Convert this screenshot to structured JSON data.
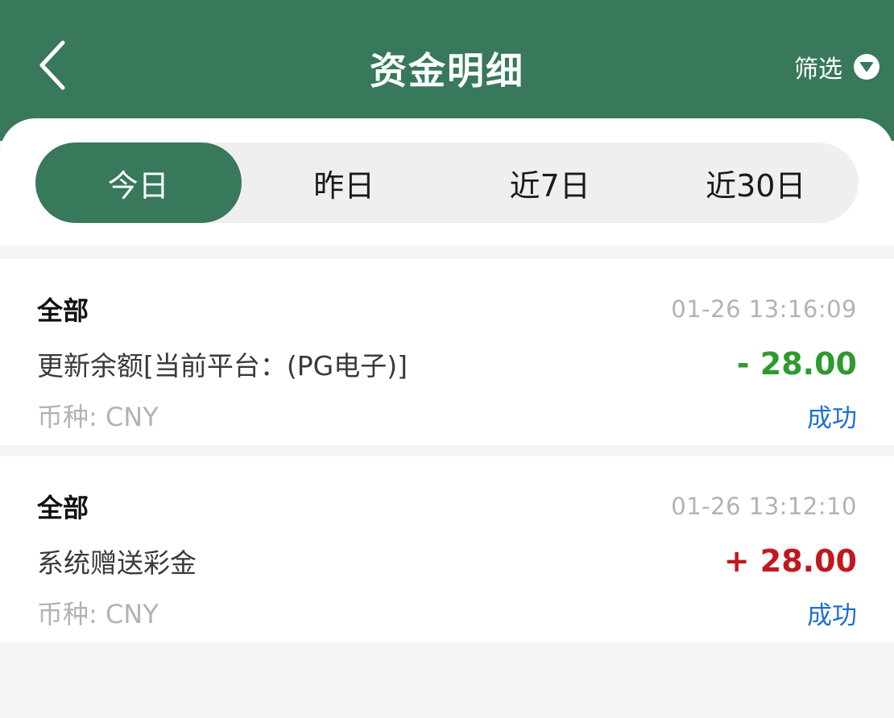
{
  "header": {
    "title": "资金明细",
    "filter_label": "筛选",
    "back_icon": "chevron-left-icon",
    "filter_icon": "caret-down-circle-icon",
    "background": "#38785b"
  },
  "tabs": [
    {
      "label": "今日",
      "active": true
    },
    {
      "label": "昨日",
      "active": false
    },
    {
      "label": "近7日",
      "active": false
    },
    {
      "label": "近30日",
      "active": false
    }
  ],
  "records": [
    {
      "type": "全部",
      "time": "01-26 13:16:09",
      "description": "更新余额[当前平台：(PG电子)]",
      "amount": "- 28.00",
      "amount_color": "#2e9a2e",
      "currency": "币种: CNY",
      "status": "成功"
    },
    {
      "type": "全部",
      "time": "01-26 13:12:10",
      "description": "系统赠送彩金",
      "amount": "+ 28.00",
      "amount_color": "#c2171d",
      "currency": "币种: CNY",
      "status": "成功"
    }
  ]
}
